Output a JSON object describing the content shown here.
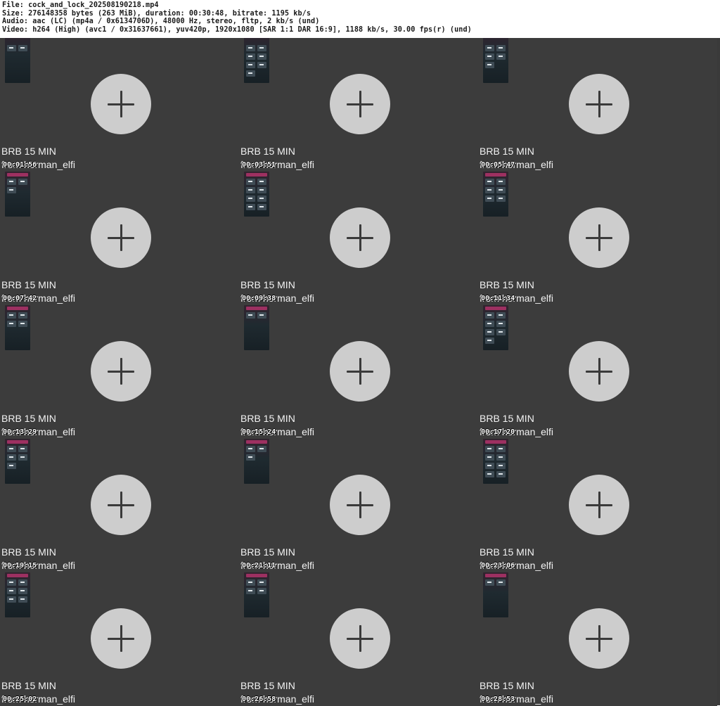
{
  "info": {
    "file": "File: cock_and_lock_202508190218.mp4",
    "size": "Size: 276148358 bytes (263 MiB), duration: 00:30:48, bitrate: 1195 kb/s",
    "audio": "Audio: aac (LC) (mp4a / 0x6134706D), 48000 Hz, stereo, fltp, 2 kb/s (und)",
    "video": "Video: h264 (High) (avc1 / 0x31637661), yuv420p, 1920x1080 [SAR 1:1 DAR 16:9], 1188 kb/s, 30.00 fps(r) (und)"
  },
  "colors": {
    "background": "#3c3c3c",
    "plus_button": "#cdcdcd",
    "plus_icon": "#3a3a3a",
    "thumb_accent": "#b0336a"
  },
  "frames": [
    {
      "title": "BRB 15 MIN",
      "subtitle": "from herman_elfi",
      "timestamp": "00:01:56",
      "icon": "plus-icon"
    },
    {
      "title": "BRB 15 MIN",
      "subtitle": "from herman_elfi",
      "timestamp": "00:03:51",
      "icon": "plus-icon"
    },
    {
      "title": "BRB 15 MIN",
      "subtitle": "from herman_elfi",
      "timestamp": "00:05:47",
      "icon": "plus-icon"
    },
    {
      "title": "BRB 15 MIN",
      "subtitle": "from herman_elfi",
      "timestamp": "00:07:42",
      "icon": "plus-icon"
    },
    {
      "title": "BRB 15 MIN",
      "subtitle": "from herman_elfi",
      "timestamp": "00:09:38",
      "icon": "plus-icon"
    },
    {
      "title": "BRB 15 MIN",
      "subtitle": "from herman_elfi",
      "timestamp": "00:11:34",
      "icon": "plus-icon"
    },
    {
      "title": "BRB 15 MIN",
      "subtitle": "from herman_elfi",
      "timestamp": "00:13:29",
      "icon": "plus-icon"
    },
    {
      "title": "BRB 15 MIN",
      "subtitle": "from herman_elfi",
      "timestamp": "00:15:24",
      "icon": "plus-icon"
    },
    {
      "title": "BRB 15 MIN",
      "subtitle": "from herman_elfi",
      "timestamp": "00:17:20",
      "icon": "plus-icon"
    },
    {
      "title": "BRB 15 MIN",
      "subtitle": "from herman_elfi",
      "timestamp": "00:19:15",
      "icon": "plus-icon"
    },
    {
      "title": "BRB 15 MIN",
      "subtitle": "from herman_elfi",
      "timestamp": "00:21:11",
      "icon": "plus-icon"
    },
    {
      "title": "BRB 15 MIN",
      "subtitle": "from herman_elfi",
      "timestamp": "00:23:06",
      "icon": "plus-icon"
    },
    {
      "title": "BRB 15 MIN",
      "subtitle": "from herman_elfi",
      "timestamp": "00:25:02",
      "icon": "plus-icon"
    },
    {
      "title": "BRB 15 MIN",
      "subtitle": "from herman_elfi",
      "timestamp": "00:26:58",
      "icon": "plus-icon"
    },
    {
      "title": "BRB 15 MIN",
      "subtitle": "from herman_elfi",
      "timestamp": "00:28:53",
      "icon": "plus-icon"
    }
  ]
}
